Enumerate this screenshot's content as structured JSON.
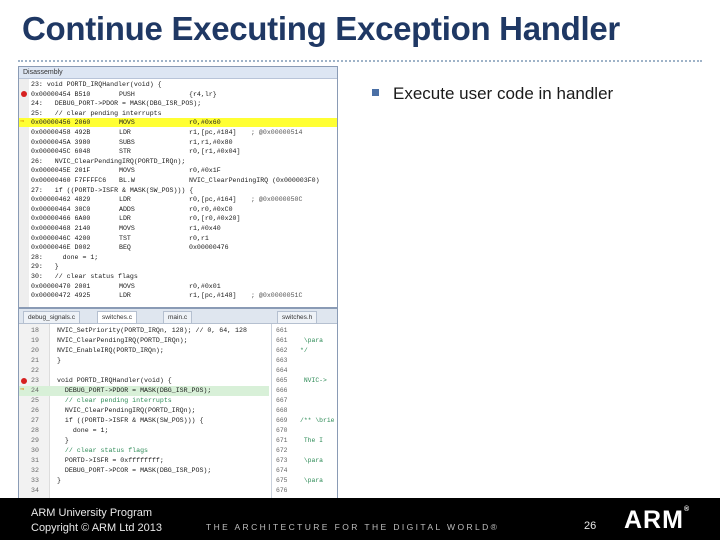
{
  "title": "Continue Executing Exception Handler",
  "bullet": "Execute user code in handler",
  "disassembly": {
    "window_title": "Disassembly",
    "lines": [
      {
        "src": "23: void PORTD_IRQHandler(void) {",
        "bp": false,
        "arrow": false,
        "hl": false
      },
      {
        "addr": "0x00000454 B510",
        "op": "PUSH",
        "args": "{r4,lr}",
        "bp": true,
        "arrow": false,
        "hl": false
      },
      {
        "src": "24:   DEBUG_PORT->PDOR = MASK(DBG_ISR_POS);",
        "bp": false,
        "arrow": false,
        "hl": false
      },
      {
        "src": "25:   // clear pending interrupts",
        "bp": false,
        "arrow": false,
        "hl": false
      },
      {
        "addr": "0x00000456 2060",
        "op": "MOVS",
        "args": "r0,#0x60",
        "bp": false,
        "arrow": true,
        "hl": true
      },
      {
        "addr": "0x00000458 492B",
        "op": "LDR",
        "args": "r1,[pc,#184]",
        "cmt": "; @0x00000514",
        "bp": false,
        "arrow": false,
        "hl": false
      },
      {
        "addr": "0x0000045A 3980",
        "op": "SUBS",
        "args": "r1,r1,#0x80",
        "bp": false,
        "arrow": false,
        "hl": false
      },
      {
        "addr": "0x0000045C 6048",
        "op": "STR",
        "args": "r0,[r1,#0x04]",
        "bp": false,
        "arrow": false,
        "hl": false
      },
      {
        "src": "26:   NVIC_ClearPendingIRQ(PORTD_IRQn);",
        "bp": false,
        "arrow": false,
        "hl": false
      },
      {
        "addr": "0x0000045E 201F",
        "op": "MOVS",
        "args": "r0,#0x1F",
        "bp": false,
        "arrow": false,
        "hl": false
      },
      {
        "addr": "0x00000460 F7FFFFC6",
        "op": "BL.W",
        "args": "NVIC_ClearPendingIRQ (0x000003F0)",
        "bp": false,
        "arrow": false,
        "hl": false
      },
      {
        "src": "27:   if ((PORTD->ISFR & MASK(SW_POS))) {",
        "bp": false,
        "arrow": false,
        "hl": false
      },
      {
        "addr": "0x00000462 4829",
        "op": "LDR",
        "args": "r0,[pc,#164]",
        "cmt": "; @0x0000050C",
        "bp": false,
        "arrow": false,
        "hl": false
      },
      {
        "addr": "0x00000464 30C0",
        "op": "ADDS",
        "args": "r0,r0,#0xC0",
        "bp": false,
        "arrow": false,
        "hl": false
      },
      {
        "addr": "0x00000466 6A00",
        "op": "LDR",
        "args": "r0,[r0,#0x20]",
        "bp": false,
        "arrow": false,
        "hl": false
      },
      {
        "addr": "0x00000468 2140",
        "op": "MOVS",
        "args": "r1,#0x40",
        "bp": false,
        "arrow": false,
        "hl": false
      },
      {
        "addr": "0x0000046C 4200",
        "op": "TST",
        "args": "r0,r1",
        "bp": false,
        "arrow": false,
        "hl": false
      },
      {
        "addr": "0x0000046E D002",
        "op": "BEQ",
        "args": "0x00000476",
        "bp": false,
        "arrow": false,
        "hl": false
      },
      {
        "src": "28:     done = 1;",
        "bp": false,
        "arrow": false,
        "hl": false
      },
      {
        "src": "29:   }",
        "bp": false,
        "arrow": false,
        "hl": false
      },
      {
        "src": "30:   // clear status flags",
        "bp": false,
        "arrow": false,
        "hl": false
      },
      {
        "addr": "0x00000470 2001",
        "op": "MOVS",
        "args": "r0,#0x01",
        "bp": false,
        "arrow": false,
        "hl": false
      },
      {
        "addr": "0x00000472 4925",
        "op": "LDR",
        "args": "r1,[pc,#148]",
        "cmt": "; @0x0000051C",
        "bp": false,
        "arrow": false,
        "hl": false
      }
    ]
  },
  "editor": {
    "tabs": [
      "debug_signals.c",
      "switches.c",
      "main.c",
      "switches.h"
    ],
    "lines": [
      {
        "ln": "18",
        "code": "NVIC_SetPriority(PORTD_IRQn, 128); // 0, 64, 128",
        "cm": false,
        "bp": false,
        "arrow": false,
        "hl": false
      },
      {
        "ln": "19",
        "code": "NVIC_ClearPendingIRQ(PORTD_IRQn);",
        "cm": false,
        "bp": false,
        "arrow": false,
        "hl": false
      },
      {
        "ln": "20",
        "code": "NVIC_EnableIRQ(PORTD_IRQn);",
        "cm": false,
        "bp": false,
        "arrow": false,
        "hl": false
      },
      {
        "ln": "21",
        "code": "}",
        "cm": false,
        "bp": false,
        "arrow": false,
        "hl": false
      },
      {
        "ln": "22",
        "code": "",
        "cm": false,
        "bp": false,
        "arrow": false,
        "hl": false
      },
      {
        "ln": "23",
        "code": "void PORTD_IRQHandler(void) {",
        "cm": false,
        "bp": true,
        "arrow": false,
        "hl": false
      },
      {
        "ln": "24",
        "code": "  DEBUG_PORT->PDOR = MASK(DBG_ISR_POS);",
        "cm": false,
        "bp": false,
        "arrow": true,
        "hl": true
      },
      {
        "ln": "25",
        "code": "  // clear pending interrupts",
        "cm": true,
        "bp": false,
        "arrow": false,
        "hl": false
      },
      {
        "ln": "26",
        "code": "  NVIC_ClearPendingIRQ(PORTD_IRQn);",
        "cm": false,
        "bp": false,
        "arrow": false,
        "hl": false
      },
      {
        "ln": "27",
        "code": "  if ((PORTD->ISFR & MASK(SW_POS))) {",
        "cm": false,
        "bp": false,
        "arrow": false,
        "hl": false
      },
      {
        "ln": "28",
        "code": "    done = 1;",
        "cm": false,
        "bp": false,
        "arrow": false,
        "hl": false
      },
      {
        "ln": "29",
        "code": "  }",
        "cm": false,
        "bp": false,
        "arrow": false,
        "hl": false
      },
      {
        "ln": "30",
        "code": "  // clear status flags",
        "cm": true,
        "bp": false,
        "arrow": false,
        "hl": false
      },
      {
        "ln": "31",
        "code": "  PORTD->ISFR = 0xffffffff;",
        "cm": false,
        "bp": false,
        "arrow": false,
        "hl": false
      },
      {
        "ln": "32",
        "code": "  DEBUG_PORT->PCOR = MASK(DBG_ISR_POS);",
        "cm": false,
        "bp": false,
        "arrow": false,
        "hl": false
      },
      {
        "ln": "33",
        "code": "}",
        "cm": false,
        "bp": false,
        "arrow": false,
        "hl": false
      },
      {
        "ln": "34",
        "code": "",
        "cm": false,
        "bp": false,
        "arrow": false,
        "hl": false
      }
    ],
    "right_lines": [
      {
        "ln": "661",
        "code": ""
      },
      {
        "ln": "661",
        "code": " \\para"
      },
      {
        "ln": "662",
        "code": "*/"
      },
      {
        "ln": "663",
        "code": ""
      },
      {
        "ln": "664",
        "code": ""
      },
      {
        "ln": "665",
        "code": " NVIC->"
      },
      {
        "ln": "666",
        "code": ""
      },
      {
        "ln": "667",
        "code": ""
      },
      {
        "ln": "668",
        "code": ""
      },
      {
        "ln": "669",
        "code": "/** \\brie"
      },
      {
        "ln": "670",
        "code": ""
      },
      {
        "ln": "671",
        "code": " The I"
      },
      {
        "ln": "672",
        "code": ""
      },
      {
        "ln": "673",
        "code": " \\para"
      },
      {
        "ln": "674",
        "code": ""
      },
      {
        "ln": "675",
        "code": " \\para"
      },
      {
        "ln": "676",
        "code": ""
      }
    ]
  },
  "footer": {
    "line1": "ARM University Program",
    "line2": "Copyright © ARM Ltd 2013",
    "tagline": "THE ARCHITECTURE FOR THE DIGITAL WORLD®",
    "page": "26",
    "logo": "ARM",
    "logo_mark": "®"
  }
}
